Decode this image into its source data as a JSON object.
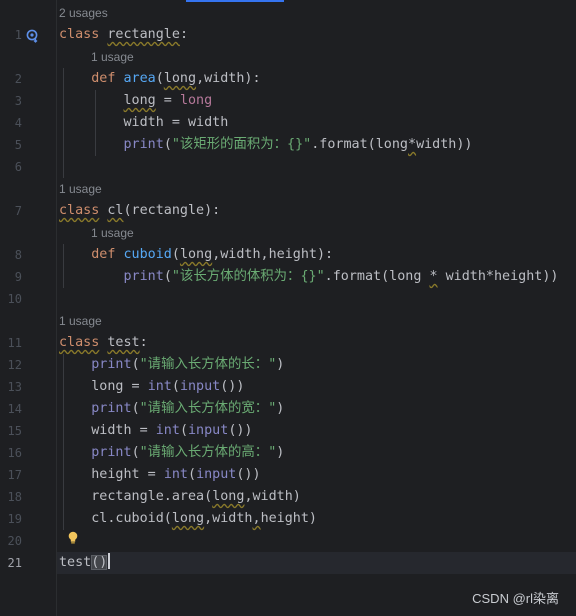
{
  "editor": {
    "usage_hints": {
      "rectangle": "2 usages",
      "area": "1 usage",
      "cl": "1 usage",
      "cuboid": "1 usage",
      "test": "1 usage"
    },
    "line_numbers": [
      "1",
      "2",
      "3",
      "4",
      "5",
      "6",
      "7",
      "8",
      "9",
      "10",
      "11",
      "12",
      "13",
      "14",
      "15",
      "16",
      "17",
      "18",
      "19",
      "20",
      "21"
    ],
    "current_line": "21",
    "str_rect_area": "\"该矩形的面积为：{}\"",
    "str_cuboid_vol": "\"该长方体的体积为：{}\"",
    "str_ask_len": "\"请输入长方体的长：\"",
    "str_ask_wid": "\"请输入长方体的宽：\"",
    "str_ask_hgt": "\"请输入长方体的高：\""
  },
  "icons": {
    "gutter_icon": "override-usage-icon",
    "bulb": "intention-bulb-icon"
  },
  "colors": {
    "background": "#1e1f22",
    "keyword": "#cf8e6d",
    "function": "#56a8f5",
    "string": "#6aab73",
    "builtin": "#8888c6",
    "parameter": "#b6799b",
    "text": "#bcbec4"
  },
  "watermark": "CSDN @rl染离"
}
